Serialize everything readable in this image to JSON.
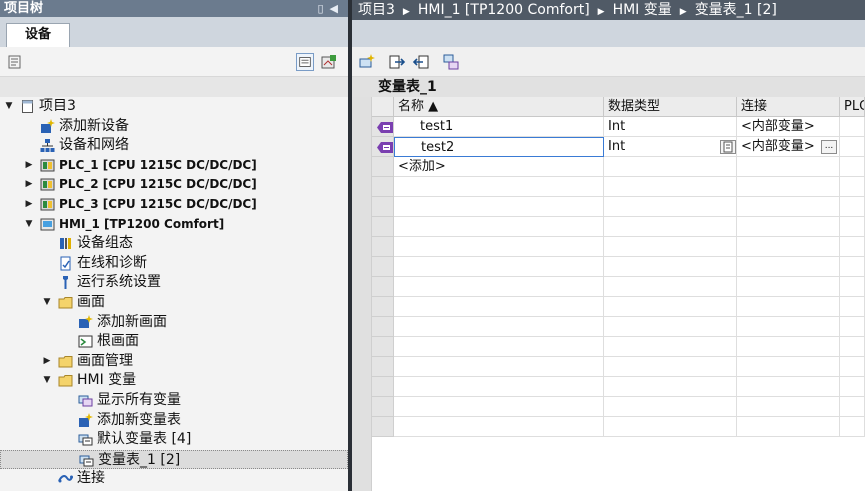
{
  "left_panel": {
    "title": "项目树",
    "tab_label": "设备",
    "tree": [
      {
        "label": "项目3",
        "bold": false,
        "indent": 0,
        "arrow": "down",
        "icon": "project-icon"
      },
      {
        "label": "添加新设备",
        "bold": false,
        "indent": 1,
        "arrow": "",
        "icon": "add-device-icon"
      },
      {
        "label": "设备和网络",
        "bold": false,
        "indent": 1,
        "arrow": "",
        "icon": "network-icon"
      },
      {
        "label": "PLC_1 [CPU 1215C DC/DC/DC]",
        "bold": true,
        "indent": 1,
        "arrow": "right",
        "icon": "plc-icon"
      },
      {
        "label": "PLC_2 [CPU 1215C DC/DC/DC]",
        "bold": true,
        "indent": 1,
        "arrow": "right",
        "icon": "plc-icon"
      },
      {
        "label": "PLC_3 [CPU 1215C DC/DC/DC]",
        "bold": true,
        "indent": 1,
        "arrow": "right",
        "icon": "plc-icon"
      },
      {
        "label": "HMI_1 [TP1200 Comfort]",
        "bold": true,
        "indent": 1,
        "arrow": "down",
        "icon": "hmi-icon"
      },
      {
        "label": "设备组态",
        "bold": false,
        "indent": 2,
        "arrow": "",
        "icon": "device-config-icon"
      },
      {
        "label": "在线和诊断",
        "bold": false,
        "indent": 2,
        "arrow": "",
        "icon": "diagnostics-icon"
      },
      {
        "label": "运行系统设置",
        "bold": false,
        "indent": 2,
        "arrow": "",
        "icon": "runtime-settings-icon"
      },
      {
        "label": "画面",
        "bold": false,
        "indent": 2,
        "arrow": "down",
        "icon": "folder-icon"
      },
      {
        "label": "添加新画面",
        "bold": false,
        "indent": 3,
        "arrow": "",
        "icon": "add-screen-icon"
      },
      {
        "label": "根画面",
        "bold": false,
        "indent": 3,
        "arrow": "",
        "icon": "screen-icon"
      },
      {
        "label": "画面管理",
        "bold": false,
        "indent": 2,
        "arrow": "right",
        "icon": "folder-icon"
      },
      {
        "label": "HMI 变量",
        "bold": false,
        "indent": 2,
        "arrow": "down",
        "icon": "folder-icon"
      },
      {
        "label": "显示所有变量",
        "bold": false,
        "indent": 3,
        "arrow": "",
        "icon": "show-tags-icon"
      },
      {
        "label": "添加新变量表",
        "bold": false,
        "indent": 3,
        "arrow": "",
        "icon": "add-tag-table-icon"
      },
      {
        "label": "默认变量表 [4]",
        "bold": false,
        "indent": 3,
        "arrow": "",
        "icon": "tag-table-icon"
      },
      {
        "label": "变量表_1 [2]",
        "bold": false,
        "indent": 3,
        "arrow": "",
        "icon": "tag-table-icon",
        "selected": true
      },
      {
        "label": "连接",
        "bold": false,
        "indent": 2,
        "arrow": "",
        "icon": "connection-icon"
      }
    ]
  },
  "breadcrumb": [
    "项目3",
    "HMI_1 [TP1200 Comfort]",
    "HMI 变量",
    "变量表_1 [2]"
  ],
  "table": {
    "title": "变量表_1",
    "columns": [
      "名称 ▲",
      "数据类型",
      "连接",
      "PLC"
    ],
    "rows": [
      {
        "name": "test1",
        "type": "Int",
        "connection": "<内部变量>"
      },
      {
        "name": "test2",
        "type": "Int",
        "connection": "<内部变量>"
      }
    ],
    "add_label": "<添加>",
    "browse_button": "..."
  },
  "colors": {
    "title_bar": "#6b7b8e",
    "breadcrumb_bar": "#505a66",
    "tab_area": "#cfd6de",
    "selection": "#3a7bd5",
    "tag_icon": "#7a3fb0"
  }
}
